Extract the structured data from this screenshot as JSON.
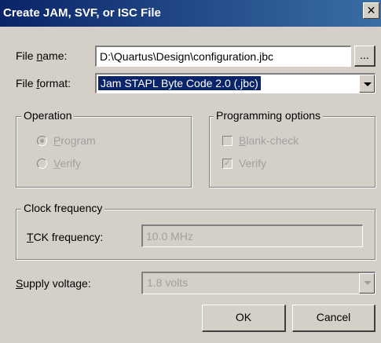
{
  "window": {
    "title": "Create JAM, SVF, or ISC File",
    "close_glyph": "✕"
  },
  "file_name": {
    "label_pre": "File ",
    "label_accel": "n",
    "label_post": "ame:",
    "value": "D:\\Quartus\\Design\\configuration.jbc",
    "browse_label": "..."
  },
  "file_format": {
    "label_pre": "File ",
    "label_accel": "f",
    "label_post": "ormat:",
    "selected": "Jam STAPL Byte Code 2.0 (.jbc)"
  },
  "operation": {
    "legend": "Operation",
    "options": [
      {
        "accel": "P",
        "rest": "rogram",
        "selected": true
      },
      {
        "accel": "V",
        "rest": "erify",
        "selected": false
      }
    ]
  },
  "programming_options": {
    "legend": "Programming options",
    "options": [
      {
        "accel": "B",
        "rest": "lank-check",
        "checked": false
      },
      {
        "accel": "",
        "rest": "Verify",
        "checked": true
      }
    ]
  },
  "clock": {
    "legend": "Clock frequency",
    "label_accel": "T",
    "label_rest": "CK frequency:",
    "value": "10.0 MHz"
  },
  "supply": {
    "label_accel": "S",
    "label_rest": "upply voltage:",
    "value": "1.8 volts"
  },
  "buttons": {
    "ok": "OK",
    "cancel": "Cancel"
  },
  "icons": {
    "check_glyph": "✓"
  }
}
